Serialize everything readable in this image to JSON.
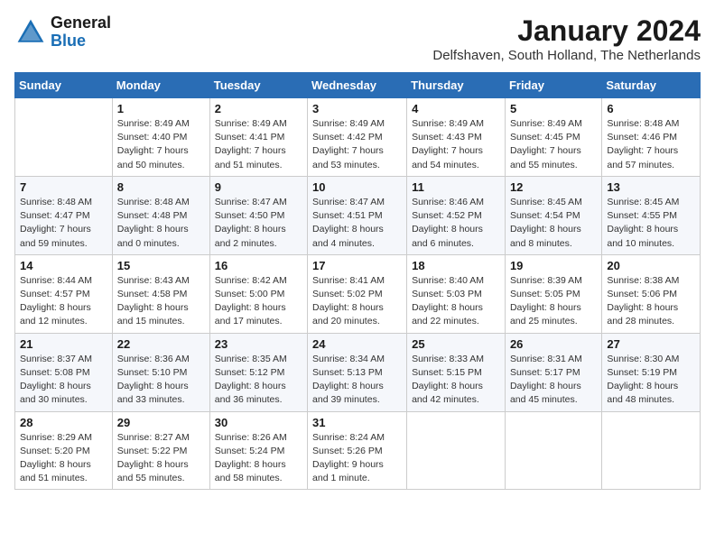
{
  "header": {
    "logo_line1": "General",
    "logo_line2": "Blue",
    "month": "January 2024",
    "location": "Delfshaven, South Holland, The Netherlands"
  },
  "weekdays": [
    "Sunday",
    "Monday",
    "Tuesday",
    "Wednesday",
    "Thursday",
    "Friday",
    "Saturday"
  ],
  "weeks": [
    [
      {
        "day": "",
        "info": ""
      },
      {
        "day": "1",
        "info": "Sunrise: 8:49 AM\nSunset: 4:40 PM\nDaylight: 7 hours\nand 50 minutes."
      },
      {
        "day": "2",
        "info": "Sunrise: 8:49 AM\nSunset: 4:41 PM\nDaylight: 7 hours\nand 51 minutes."
      },
      {
        "day": "3",
        "info": "Sunrise: 8:49 AM\nSunset: 4:42 PM\nDaylight: 7 hours\nand 53 minutes."
      },
      {
        "day": "4",
        "info": "Sunrise: 8:49 AM\nSunset: 4:43 PM\nDaylight: 7 hours\nand 54 minutes."
      },
      {
        "day": "5",
        "info": "Sunrise: 8:49 AM\nSunset: 4:45 PM\nDaylight: 7 hours\nand 55 minutes."
      },
      {
        "day": "6",
        "info": "Sunrise: 8:48 AM\nSunset: 4:46 PM\nDaylight: 7 hours\nand 57 minutes."
      }
    ],
    [
      {
        "day": "7",
        "info": "Sunrise: 8:48 AM\nSunset: 4:47 PM\nDaylight: 7 hours\nand 59 minutes."
      },
      {
        "day": "8",
        "info": "Sunrise: 8:48 AM\nSunset: 4:48 PM\nDaylight: 8 hours\nand 0 minutes."
      },
      {
        "day": "9",
        "info": "Sunrise: 8:47 AM\nSunset: 4:50 PM\nDaylight: 8 hours\nand 2 minutes."
      },
      {
        "day": "10",
        "info": "Sunrise: 8:47 AM\nSunset: 4:51 PM\nDaylight: 8 hours\nand 4 minutes."
      },
      {
        "day": "11",
        "info": "Sunrise: 8:46 AM\nSunset: 4:52 PM\nDaylight: 8 hours\nand 6 minutes."
      },
      {
        "day": "12",
        "info": "Sunrise: 8:45 AM\nSunset: 4:54 PM\nDaylight: 8 hours\nand 8 minutes."
      },
      {
        "day": "13",
        "info": "Sunrise: 8:45 AM\nSunset: 4:55 PM\nDaylight: 8 hours\nand 10 minutes."
      }
    ],
    [
      {
        "day": "14",
        "info": "Sunrise: 8:44 AM\nSunset: 4:57 PM\nDaylight: 8 hours\nand 12 minutes."
      },
      {
        "day": "15",
        "info": "Sunrise: 8:43 AM\nSunset: 4:58 PM\nDaylight: 8 hours\nand 15 minutes."
      },
      {
        "day": "16",
        "info": "Sunrise: 8:42 AM\nSunset: 5:00 PM\nDaylight: 8 hours\nand 17 minutes."
      },
      {
        "day": "17",
        "info": "Sunrise: 8:41 AM\nSunset: 5:02 PM\nDaylight: 8 hours\nand 20 minutes."
      },
      {
        "day": "18",
        "info": "Sunrise: 8:40 AM\nSunset: 5:03 PM\nDaylight: 8 hours\nand 22 minutes."
      },
      {
        "day": "19",
        "info": "Sunrise: 8:39 AM\nSunset: 5:05 PM\nDaylight: 8 hours\nand 25 minutes."
      },
      {
        "day": "20",
        "info": "Sunrise: 8:38 AM\nSunset: 5:06 PM\nDaylight: 8 hours\nand 28 minutes."
      }
    ],
    [
      {
        "day": "21",
        "info": "Sunrise: 8:37 AM\nSunset: 5:08 PM\nDaylight: 8 hours\nand 30 minutes."
      },
      {
        "day": "22",
        "info": "Sunrise: 8:36 AM\nSunset: 5:10 PM\nDaylight: 8 hours\nand 33 minutes."
      },
      {
        "day": "23",
        "info": "Sunrise: 8:35 AM\nSunset: 5:12 PM\nDaylight: 8 hours\nand 36 minutes."
      },
      {
        "day": "24",
        "info": "Sunrise: 8:34 AM\nSunset: 5:13 PM\nDaylight: 8 hours\nand 39 minutes."
      },
      {
        "day": "25",
        "info": "Sunrise: 8:33 AM\nSunset: 5:15 PM\nDaylight: 8 hours\nand 42 minutes."
      },
      {
        "day": "26",
        "info": "Sunrise: 8:31 AM\nSunset: 5:17 PM\nDaylight: 8 hours\nand 45 minutes."
      },
      {
        "day": "27",
        "info": "Sunrise: 8:30 AM\nSunset: 5:19 PM\nDaylight: 8 hours\nand 48 minutes."
      }
    ],
    [
      {
        "day": "28",
        "info": "Sunrise: 8:29 AM\nSunset: 5:20 PM\nDaylight: 8 hours\nand 51 minutes."
      },
      {
        "day": "29",
        "info": "Sunrise: 8:27 AM\nSunset: 5:22 PM\nDaylight: 8 hours\nand 55 minutes."
      },
      {
        "day": "30",
        "info": "Sunrise: 8:26 AM\nSunset: 5:24 PM\nDaylight: 8 hours\nand 58 minutes."
      },
      {
        "day": "31",
        "info": "Sunrise: 8:24 AM\nSunset: 5:26 PM\nDaylight: 9 hours\nand 1 minute."
      },
      {
        "day": "",
        "info": ""
      },
      {
        "day": "",
        "info": ""
      },
      {
        "day": "",
        "info": ""
      }
    ]
  ]
}
